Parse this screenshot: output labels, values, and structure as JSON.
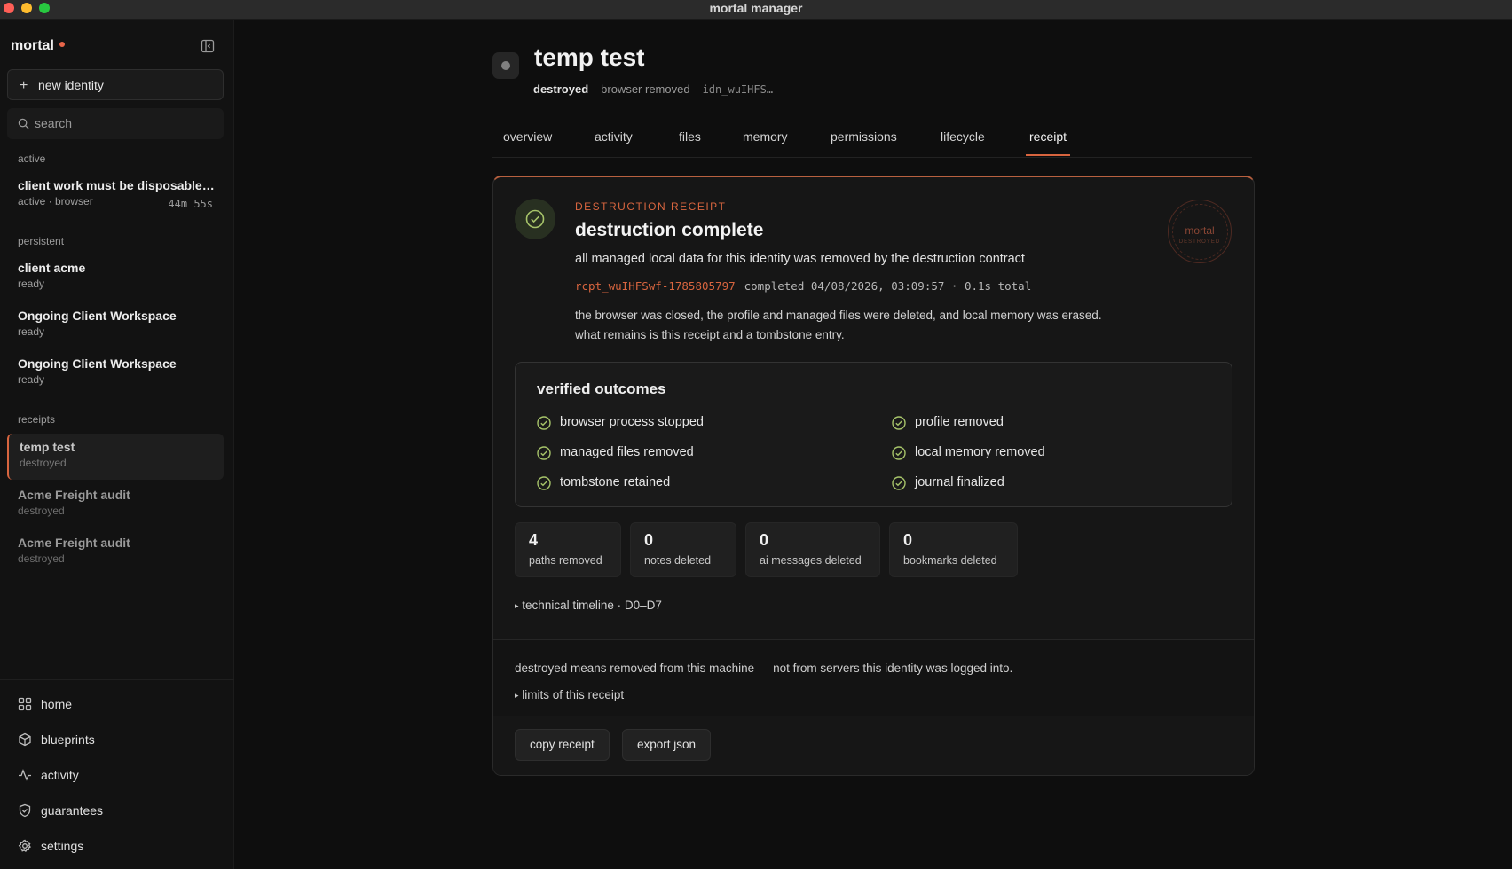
{
  "window": {
    "title": "mortal manager"
  },
  "sidebar": {
    "brand": "mortal",
    "new_identity_label": "new identity",
    "search_placeholder": "search",
    "sections": {
      "active": "active",
      "persistent": "persistent",
      "receipts": "receipts"
    },
    "active_items": [
      {
        "name": "client work must be disposable ...",
        "sub": "active · browser",
        "time": "44m 55s"
      }
    ],
    "persistent_items": [
      {
        "name": "client acme",
        "sub": "ready"
      },
      {
        "name": "Ongoing Client Workspace",
        "sub": "ready"
      },
      {
        "name": "Ongoing Client Workspace",
        "sub": "ready"
      }
    ],
    "receipt_items": [
      {
        "name": "temp test",
        "sub": "destroyed"
      },
      {
        "name": "Acme Freight audit",
        "sub": "destroyed"
      },
      {
        "name": "Acme Freight audit",
        "sub": "destroyed"
      }
    ],
    "nav": [
      {
        "label": "home",
        "icon": "grid-icon"
      },
      {
        "label": "blueprints",
        "icon": "cube-icon"
      },
      {
        "label": "activity",
        "icon": "pulse-icon"
      },
      {
        "label": "guarantees",
        "icon": "shield-check-icon"
      },
      {
        "label": "settings",
        "icon": "gear-icon"
      }
    ]
  },
  "header": {
    "title": "temp test",
    "status": "destroyed",
    "browser_state": "browser removed",
    "identity_id": "idn_wuIHFS…"
  },
  "tabs": [
    "overview",
    "activity",
    "files",
    "memory",
    "permissions",
    "lifecycle",
    "receipt"
  ],
  "active_tab": "receipt",
  "receipt": {
    "eyebrow": "DESTRUCTION RECEIPT",
    "title": "destruction complete",
    "description": "all managed local data for this identity was removed by the destruction contract",
    "receipt_id": "rcpt_wuIHFSwf-1785805797",
    "completed": "completed 04/08/2026, 03:09:57 · 0.1s total",
    "body": "the browser was closed, the profile and managed files were deleted, and local memory was erased. what remains is this receipt and a tombstone entry.",
    "stamp_top": "mortal",
    "stamp_bottom": "DESTROYED",
    "outcomes_title": "verified outcomes",
    "outcomes": [
      "browser process stopped",
      "profile removed",
      "managed files removed",
      "local memory removed",
      "tombstone retained",
      "journal finalized"
    ],
    "stats": [
      {
        "value": "4",
        "label": "paths removed"
      },
      {
        "value": "0",
        "label": "notes deleted"
      },
      {
        "value": "0",
        "label": "ai messages deleted"
      },
      {
        "value": "0",
        "label": "bookmarks deleted"
      }
    ],
    "timeline_toggle": "technical timeline · D0–D7",
    "footer_note": "destroyed means removed from this machine — not from servers this identity was logged into.",
    "limits_toggle": "limits of this receipt",
    "copy_label": "copy receipt",
    "export_label": "export json"
  },
  "colors": {
    "accent": "#d8653f",
    "success": "#a7c46a",
    "background": "#0e0e0e"
  }
}
